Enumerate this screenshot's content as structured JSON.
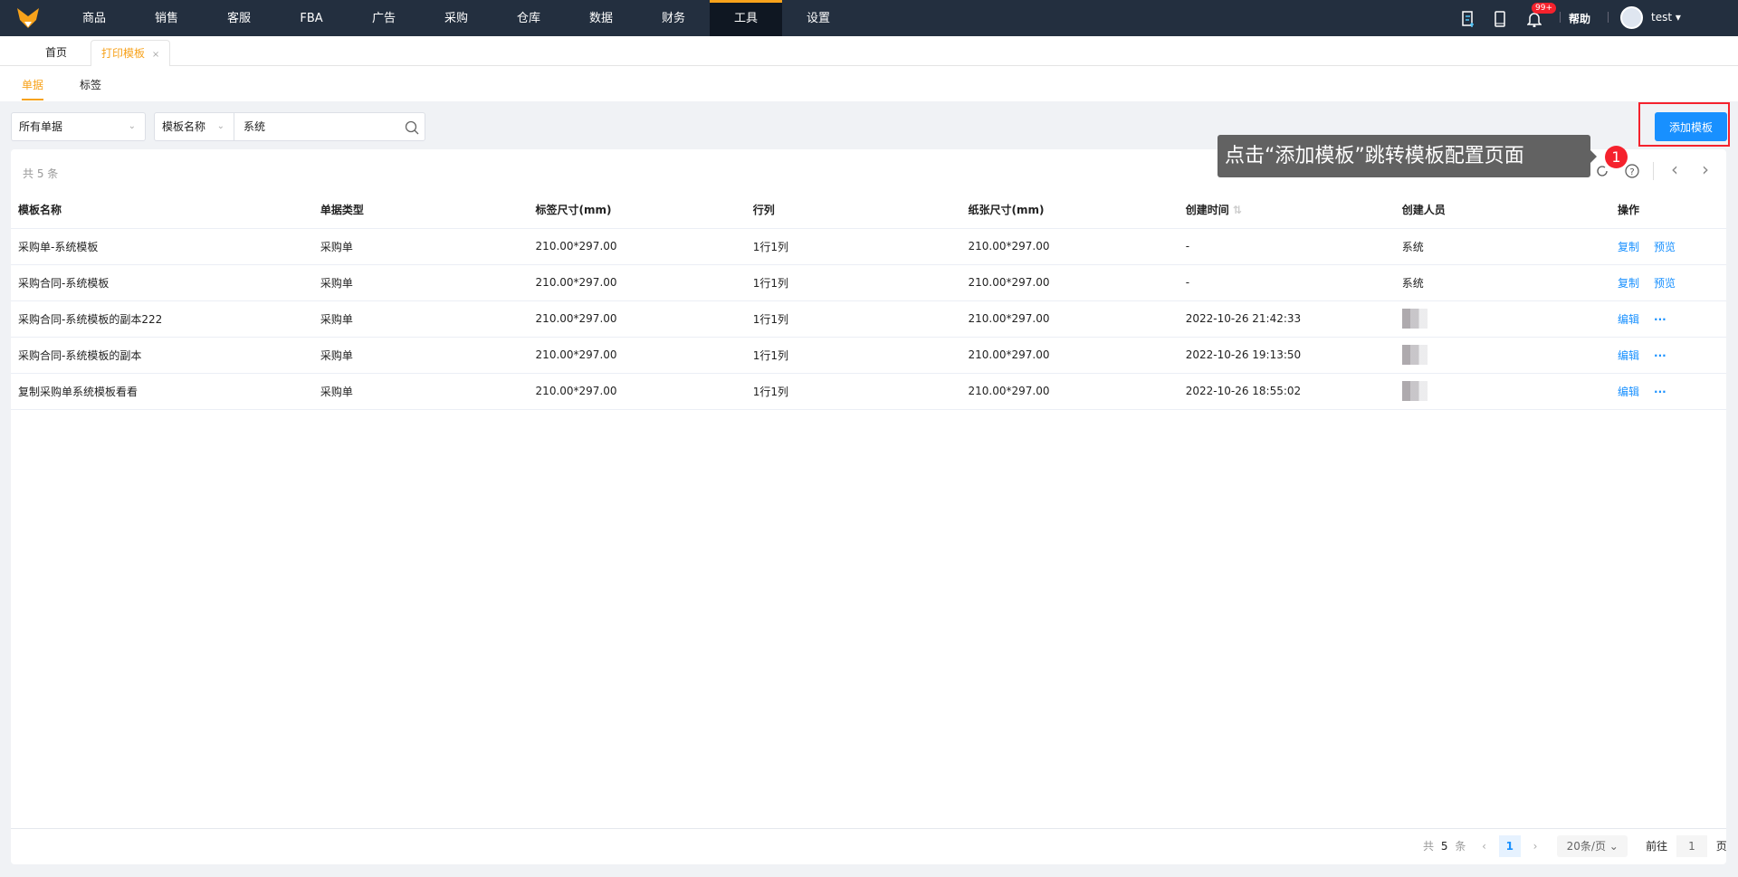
{
  "nav": {
    "items": [
      "商品",
      "销售",
      "客服",
      "FBA",
      "广告",
      "采购",
      "仓库",
      "数据",
      "财务",
      "工具",
      "设置"
    ],
    "active": 9,
    "help": "帮助",
    "user": "test",
    "badge": "99+"
  },
  "tabs": {
    "home": "首页",
    "current": "打印模板",
    "close": "×"
  },
  "subtabs": [
    "单据",
    "标签"
  ],
  "filters": {
    "type": "所有单据",
    "field": "模板名称",
    "search_value": "系统"
  },
  "add_button": "添加模板",
  "tooltip": {
    "text": "点击“添加模板”跳转模板配置页面",
    "step": "1"
  },
  "summary": "共 5 条",
  "columns": [
    "模板名称",
    "单据类型",
    "标签尺寸(mm)",
    "行列",
    "纸张尺寸(mm)",
    "创建时间",
    "创建人员",
    "操作"
  ],
  "rows": [
    {
      "name": "采购单-系统模板",
      "type": "采购单",
      "label": "210.00*297.00",
      "grid": "1行1列",
      "paper": "210.00*297.00",
      "time": "-",
      "creator": "系统",
      "actions": [
        "复制",
        "预览"
      ]
    },
    {
      "name": "采购合同-系统模板",
      "type": "采购单",
      "label": "210.00*297.00",
      "grid": "1行1列",
      "paper": "210.00*297.00",
      "time": "-",
      "creator": "系统",
      "actions": [
        "复制",
        "预览"
      ]
    },
    {
      "name": "采购合同-系统模板的副本222",
      "type": "采购单",
      "label": "210.00*297.00",
      "grid": "1行1列",
      "paper": "210.00*297.00",
      "time": "2022-10-26 21:42:33",
      "creator": "",
      "actions": [
        "编辑",
        "···"
      ]
    },
    {
      "name": "采购合同-系统模板的副本",
      "type": "采购单",
      "label": "210.00*297.00",
      "grid": "1行1列",
      "paper": "210.00*297.00",
      "time": "2022-10-26 19:13:50",
      "creator": "",
      "actions": [
        "编辑",
        "···"
      ]
    },
    {
      "name": "复制采购单系统模板看看",
      "type": "采购单",
      "label": "210.00*297.00",
      "grid": "1行1列",
      "paper": "210.00*297.00",
      "time": "2022-10-26 18:55:02",
      "creator": "",
      "actions": [
        "编辑",
        "···"
      ]
    }
  ],
  "pagination": {
    "total_prefix": "共",
    "total": "5",
    "total_suffix": "条",
    "page": "1",
    "page_size": "20条/页",
    "goto": "前往",
    "goto_value": "1",
    "page_suffix": "页"
  },
  "colors": {
    "accent": "#f7a21b",
    "primary": "#1890ff",
    "nav": "#232f3f",
    "highlight": "#f5222d"
  }
}
